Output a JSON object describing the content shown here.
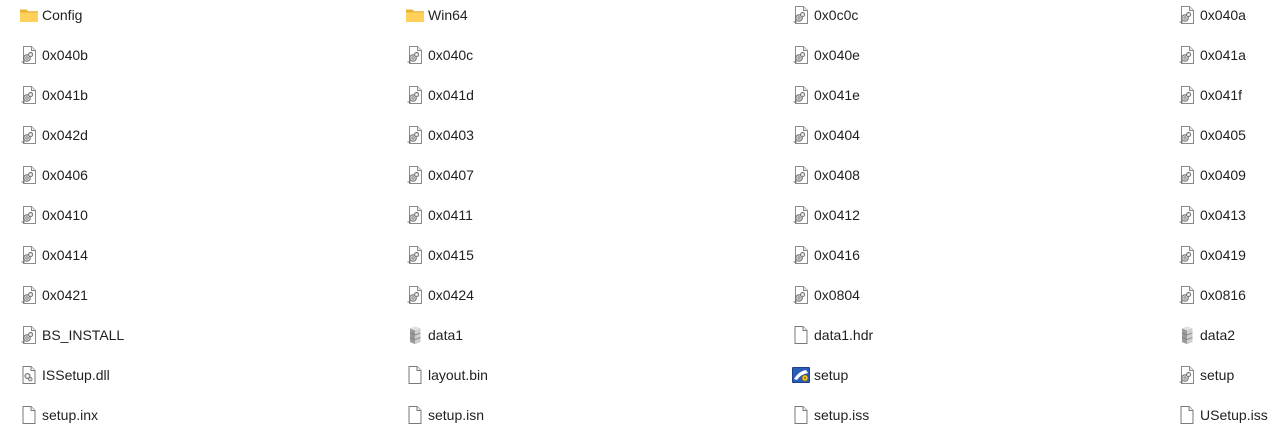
{
  "items": [
    {
      "name": "Config",
      "icon": "folder-icon"
    },
    {
      "name": "Win64",
      "icon": "folder-icon"
    },
    {
      "name": "0x0c0c",
      "icon": "settings-file-icon"
    },
    {
      "name": "0x040a",
      "icon": "settings-file-icon"
    },
    {
      "name": "0x040b",
      "icon": "settings-file-icon"
    },
    {
      "name": "0x040c",
      "icon": "settings-file-icon"
    },
    {
      "name": "0x040e",
      "icon": "settings-file-icon"
    },
    {
      "name": "0x041a",
      "icon": "settings-file-icon"
    },
    {
      "name": "0x041b",
      "icon": "settings-file-icon"
    },
    {
      "name": "0x041d",
      "icon": "settings-file-icon"
    },
    {
      "name": "0x041e",
      "icon": "settings-file-icon"
    },
    {
      "name": "0x041f",
      "icon": "settings-file-icon"
    },
    {
      "name": "0x042d",
      "icon": "settings-file-icon"
    },
    {
      "name": "0x0403",
      "icon": "settings-file-icon"
    },
    {
      "name": "0x0404",
      "icon": "settings-file-icon"
    },
    {
      "name": "0x0405",
      "icon": "settings-file-icon"
    },
    {
      "name": "0x0406",
      "icon": "settings-file-icon"
    },
    {
      "name": "0x0407",
      "icon": "settings-file-icon"
    },
    {
      "name": "0x0408",
      "icon": "settings-file-icon"
    },
    {
      "name": "0x0409",
      "icon": "settings-file-icon"
    },
    {
      "name": "0x0410",
      "icon": "settings-file-icon"
    },
    {
      "name": "0x0411",
      "icon": "settings-file-icon"
    },
    {
      "name": "0x0412",
      "icon": "settings-file-icon"
    },
    {
      "name": "0x0413",
      "icon": "settings-file-icon"
    },
    {
      "name": "0x0414",
      "icon": "settings-file-icon"
    },
    {
      "name": "0x0415",
      "icon": "settings-file-icon"
    },
    {
      "name": "0x0416",
      "icon": "settings-file-icon"
    },
    {
      "name": "0x0419",
      "icon": "settings-file-icon"
    },
    {
      "name": "0x0421",
      "icon": "settings-file-icon"
    },
    {
      "name": "0x0424",
      "icon": "settings-file-icon"
    },
    {
      "name": "0x0804",
      "icon": "settings-file-icon"
    },
    {
      "name": "0x0816",
      "icon": "settings-file-icon"
    },
    {
      "name": "BS_INSTALL",
      "icon": "settings-file-icon"
    },
    {
      "name": "data1",
      "icon": "cabinet-file-icon"
    },
    {
      "name": "data1.hdr",
      "icon": "blank-file-icon"
    },
    {
      "name": "data2",
      "icon": "cabinet-file-icon"
    },
    {
      "name": "ISSetup.dll",
      "icon": "dll-file-icon"
    },
    {
      "name": "layout.bin",
      "icon": "blank-file-icon"
    },
    {
      "name": "setup",
      "icon": "setup-app-icon"
    },
    {
      "name": "setup",
      "icon": "settings-file-icon"
    },
    {
      "name": "setup.inx",
      "icon": "blank-file-icon"
    },
    {
      "name": "setup.isn",
      "icon": "blank-file-icon"
    },
    {
      "name": "setup.iss",
      "icon": "blank-file-icon"
    },
    {
      "name": "USetup.iss",
      "icon": "blank-file-icon"
    }
  ]
}
